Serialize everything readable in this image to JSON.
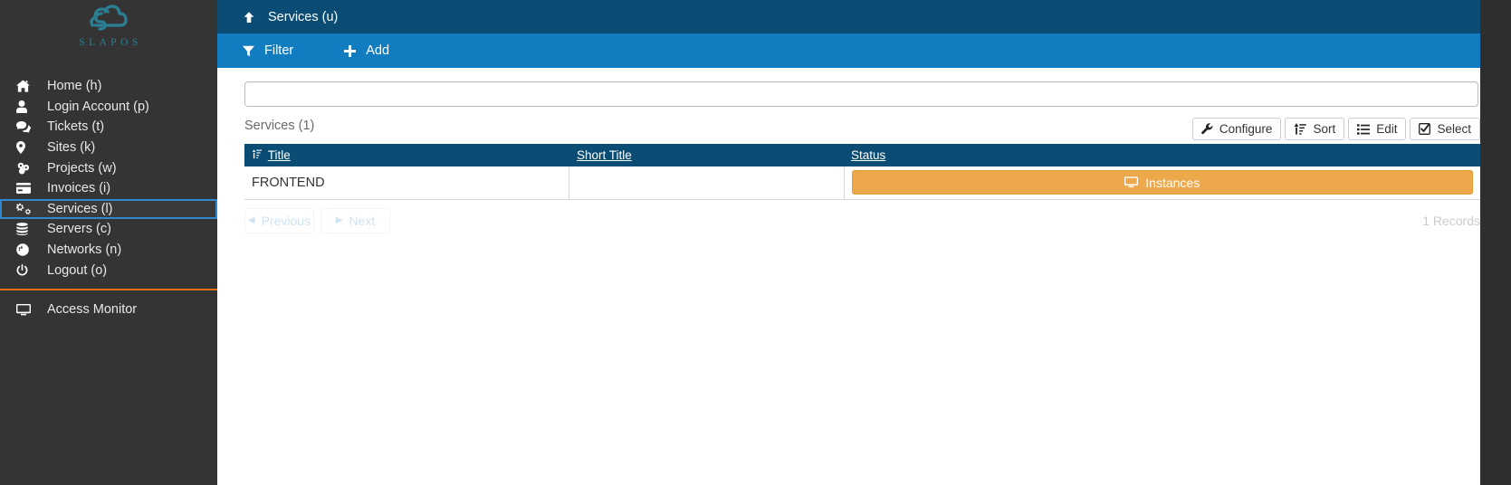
{
  "brand": {
    "logo_text": "SLAPOS",
    "logo_icon": "cloud-s-logo",
    "logo_color": "#2a7f92"
  },
  "sidebar": {
    "items": [
      {
        "label": "Home (h)",
        "icon": "home-icon",
        "active": false
      },
      {
        "label": "Login Account (p)",
        "icon": "user-icon",
        "active": false
      },
      {
        "label": "Tickets (t)",
        "icon": "comments-icon",
        "active": false
      },
      {
        "label": "Sites (k)",
        "icon": "map-marker-icon",
        "active": false
      },
      {
        "label": "Projects (w)",
        "icon": "cubes-icon",
        "active": false
      },
      {
        "label": "Invoices (i)",
        "icon": "credit-card-icon",
        "active": false
      },
      {
        "label": "Services (l)",
        "icon": "cogs-icon",
        "active": true
      },
      {
        "label": "Servers (c)",
        "icon": "database-icon",
        "active": false
      },
      {
        "label": "Networks (n)",
        "icon": "globe-icon",
        "active": false
      },
      {
        "label": "Logout (o)",
        "icon": "power-off-icon",
        "active": false
      }
    ],
    "separator_color": "#e8721c",
    "bottom_items": [
      {
        "label": "Access Monitor",
        "icon": "desktop-icon"
      }
    ]
  },
  "header": {
    "title": "Services (u)",
    "up_icon": "arrow-up-icon",
    "bg_color": "#0a4c74"
  },
  "toolbar": {
    "bg_color": "#127cc1",
    "buttons": [
      {
        "label": "Filter",
        "icon": "filter-icon"
      },
      {
        "label": "Add",
        "icon": "plus-icon"
      }
    ]
  },
  "search": {
    "value": "",
    "placeholder": "",
    "icon": "search-icon"
  },
  "listing": {
    "caption": "Services (1)",
    "actions": [
      {
        "label": "Configure",
        "icon": "wrench-icon"
      },
      {
        "label": "Sort",
        "icon": "sort-amount-down-icon"
      },
      {
        "label": "Edit",
        "icon": "list-icon"
      },
      {
        "label": "Select",
        "icon": "check-square-icon"
      }
    ],
    "columns": [
      {
        "label": "Title",
        "sorted": true,
        "sort_icon": "sort-asc-icon"
      },
      {
        "label": "Short Title",
        "sorted": false
      },
      {
        "label": "Status",
        "sorted": false
      }
    ],
    "rows": [
      {
        "title": "FRONTEND",
        "short_title": "",
        "status_label": "Instances",
        "status_icon": "desktop-icon",
        "status_color": "#eda84b"
      }
    ],
    "header_bg": "#0a4c74"
  },
  "pagination": {
    "previous_label": "Previous",
    "previous_icon": "caret-left-icon",
    "next_label": "Next",
    "next_icon": "caret-right-icon",
    "records_label": "1 Records"
  }
}
